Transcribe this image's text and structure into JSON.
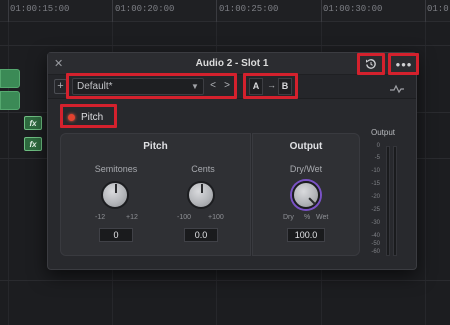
{
  "timeline": {
    "timecodes": [
      "01:00:15:00",
      "01:00:20:00",
      "01:00:25:00",
      "01:00:30:00",
      "01:0"
    ],
    "fx_badge_label": "fx"
  },
  "plugin": {
    "title": "Audio 2 - Slot 1",
    "close_icon": "close-icon",
    "reset_icon": "reset-icon",
    "more_label": "•••",
    "toolbar": {
      "add_label": "+",
      "preset_value": "Default*",
      "prev_label": "<",
      "next_label": ">",
      "a_label": "A",
      "copy_label": "→",
      "b_label": "B"
    },
    "bypass": {
      "label": "Pitch",
      "led_color": "#e2422f"
    },
    "pitch_section": {
      "title": "Pitch",
      "semitones": {
        "label": "Semitones",
        "min": "-12",
        "max": "+12",
        "value": "0"
      },
      "cents": {
        "label": "Cents",
        "min": "-100",
        "max": "+100",
        "value": "0.0"
      }
    },
    "output_section": {
      "title": "Output",
      "drywet": {
        "label": "Dry/Wet",
        "dry": "Dry",
        "percent": "%",
        "wet": "Wet",
        "value": "100.0"
      }
    },
    "meter": {
      "title": "Output",
      "scale": [
        "0",
        "-5",
        "-10",
        "-15",
        "-20",
        "-25",
        "-30",
        "-40",
        "-50",
        "-60"
      ]
    }
  },
  "colors": {
    "highlight": "#d4212d",
    "accent_purple": "#7a52c6",
    "clip_green": "#3b8a56"
  }
}
